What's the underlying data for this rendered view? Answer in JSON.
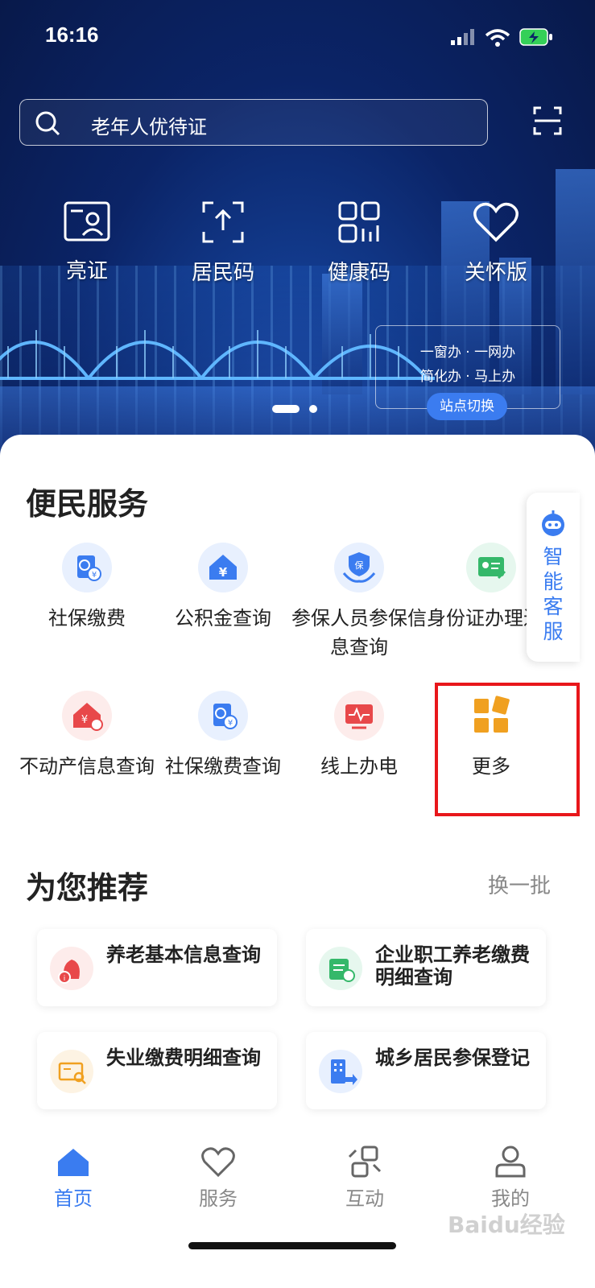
{
  "status_bar": {
    "time": "16:16"
  },
  "search": {
    "placeholder": "老年人优待证"
  },
  "quick_actions": [
    {
      "label": "亮证",
      "icon": "id-card-icon"
    },
    {
      "label": "居民码",
      "icon": "upload-code-icon"
    },
    {
      "label": "健康码",
      "icon": "qr-grid-icon"
    },
    {
      "label": "关怀版",
      "icon": "heart-icon"
    }
  ],
  "banner": {
    "slogan_line1": "一窗办 · 一网办",
    "slogan_line2": "简化办 · 马上办",
    "switch_label": "站点切换"
  },
  "convenience": {
    "title": "便民服务",
    "items": [
      {
        "label": "社保缴费",
        "icon": "passport-yuan-icon",
        "color": "#3b7cf0"
      },
      {
        "label": "公积金查询",
        "icon": "house-yuan-icon",
        "color": "#3b7cf0"
      },
      {
        "label": "参保人员参保信息查询",
        "icon": "shield-hands-icon",
        "color": "#3b7cf0"
      },
      {
        "label": "身份证办理进度查询",
        "icon": "id-card-edit-icon",
        "color": "#35b86a"
      },
      {
        "label": "不动产信息查询",
        "icon": "house-yuan-red-icon",
        "color": "#e8484a"
      },
      {
        "label": "社保缴费查询",
        "icon": "passport-yuan-icon",
        "color": "#3b7cf0"
      },
      {
        "label": "线上办电",
        "icon": "monitor-pulse-icon",
        "color": "#e8484a"
      },
      {
        "label": "更多",
        "icon": "grid-more-icon",
        "color": "#f0a020"
      }
    ]
  },
  "assistant": {
    "label": "智能客服"
  },
  "recommend": {
    "title": "为您推荐",
    "refresh": "换一批",
    "items": [
      {
        "label": "养老基本信息查询",
        "icon": "pension-icon",
        "color": "#e8484a"
      },
      {
        "label": "企业职工养老缴费明细查询",
        "icon": "payment-detail-icon",
        "color": "#35b86a"
      },
      {
        "label": "失业缴费明细查询",
        "icon": "id-search-icon",
        "color": "#f0a020"
      },
      {
        "label": "城乡居民参保登记",
        "icon": "building-icon",
        "color": "#3b7cf0"
      }
    ]
  },
  "tabs": [
    {
      "label": "首页",
      "icon": "home-icon",
      "active": true
    },
    {
      "label": "服务",
      "icon": "heart-outline-icon",
      "active": false
    },
    {
      "label": "互动",
      "icon": "exchange-icon",
      "active": false
    },
    {
      "label": "我的",
      "icon": "user-icon",
      "active": false
    }
  ],
  "watermark": "Baidu经验"
}
